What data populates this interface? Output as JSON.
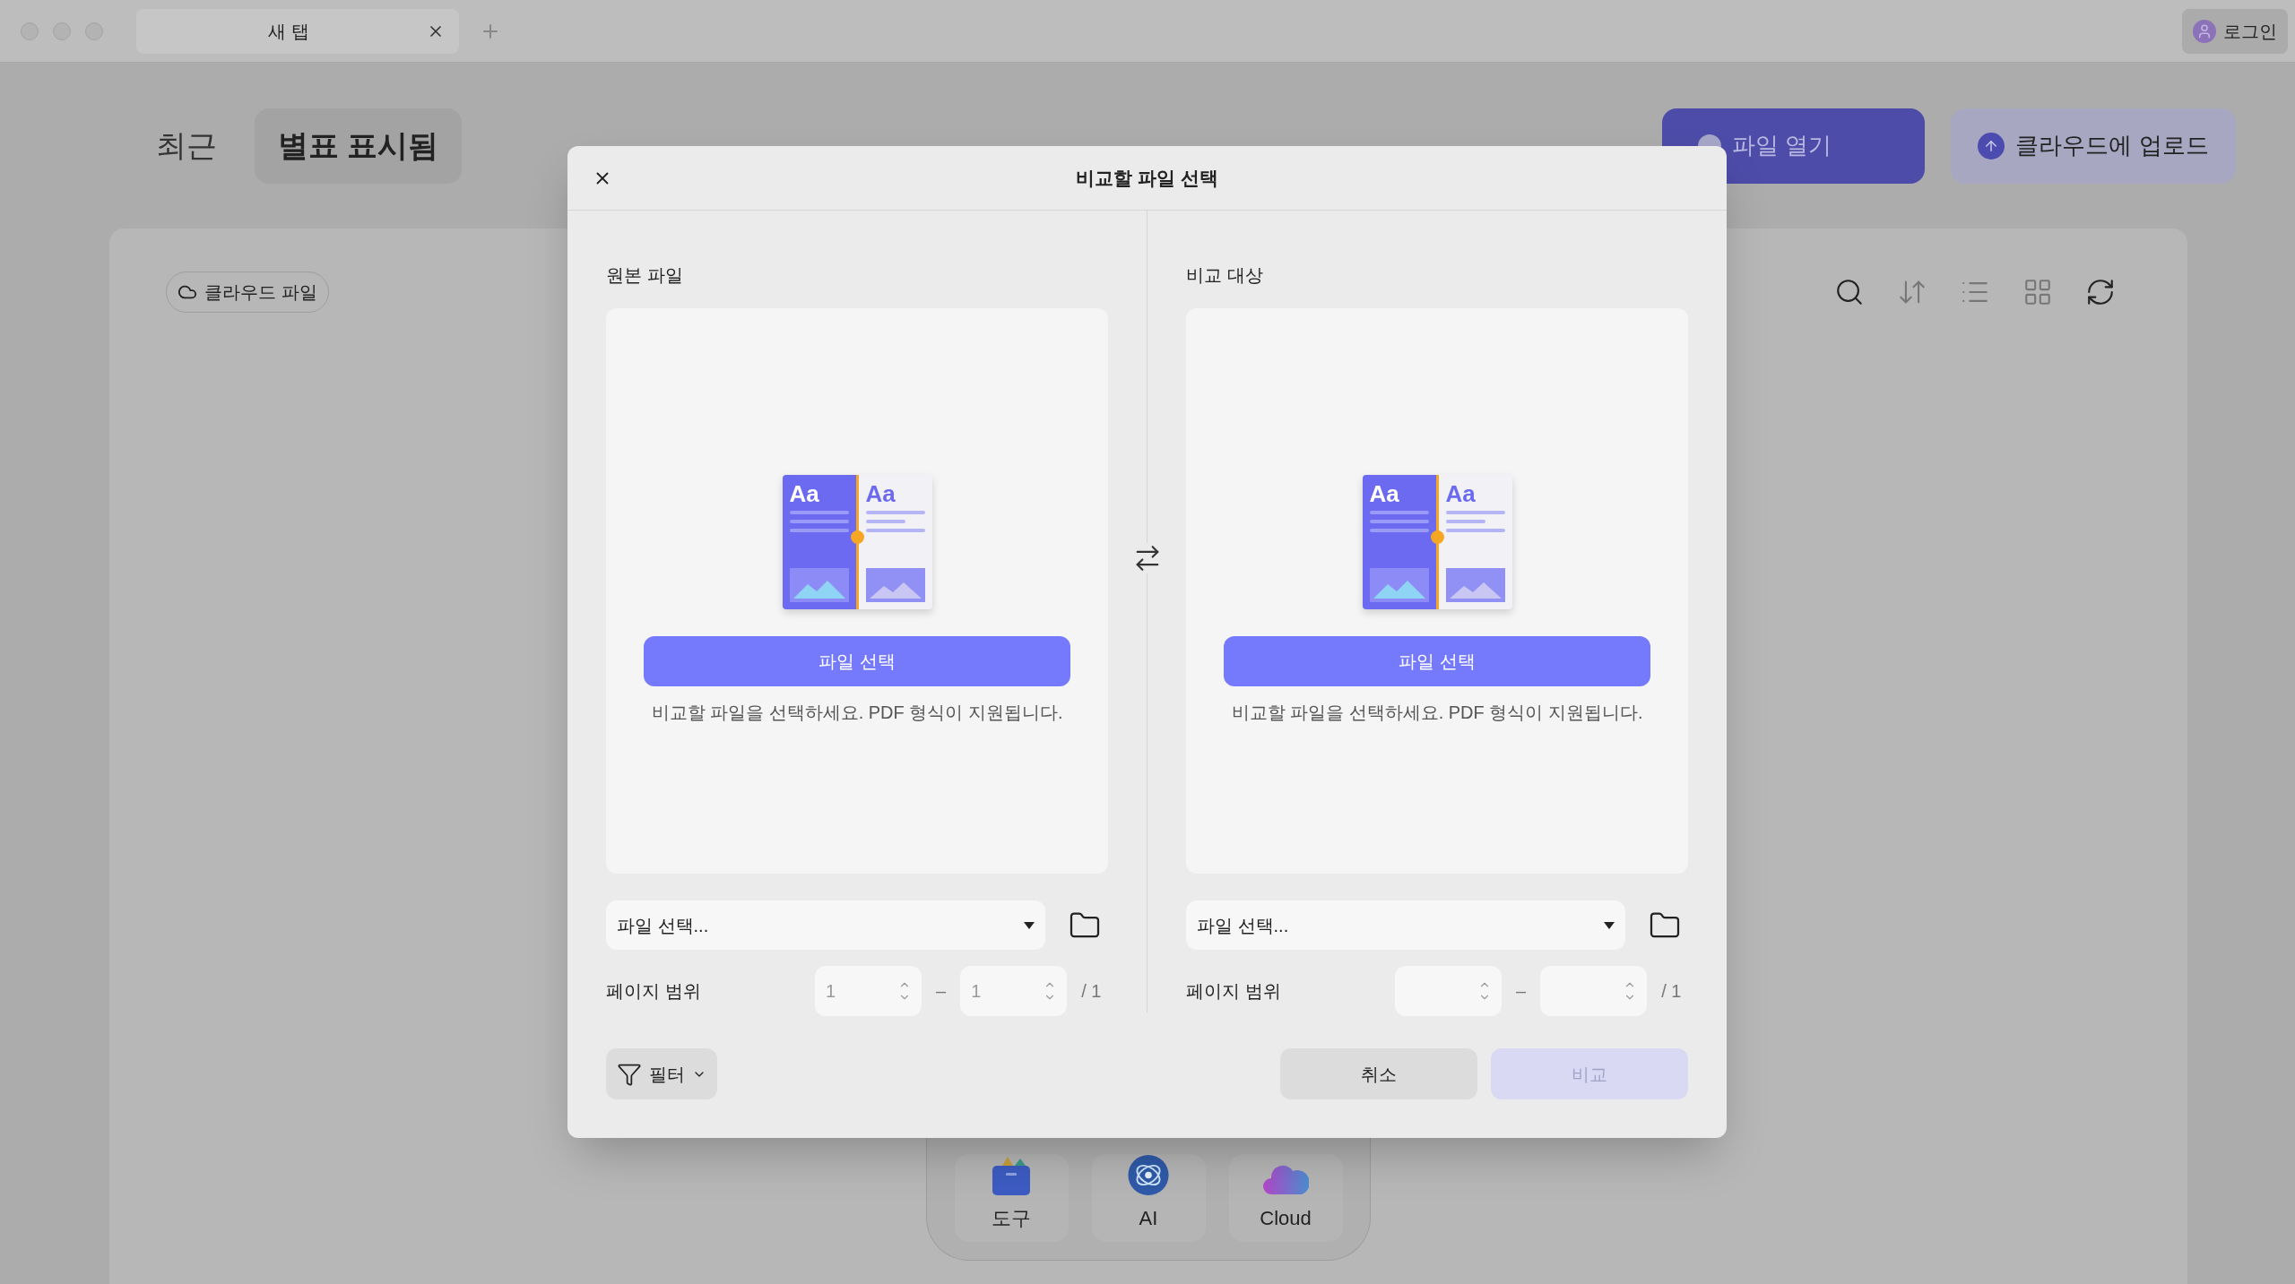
{
  "tab_bar": {
    "tabs": [
      {
        "label": "새 탭",
        "selected": true
      }
    ],
    "login": "로그인"
  },
  "header": {
    "nav": [
      {
        "label": "최근",
        "selected": false
      },
      {
        "label": "별표 표시됨",
        "selected": true
      }
    ],
    "open_file": "파일 열기",
    "upload": "클라우드에 업로드"
  },
  "content": {
    "filter_chip": "클라우드 파일"
  },
  "dock": [
    {
      "kind": "tools",
      "label": "도구"
    },
    {
      "kind": "ai",
      "label": "AI"
    },
    {
      "kind": "cloud",
      "label": "Cloud"
    }
  ],
  "dialog": {
    "title": "비교할 파일 선택",
    "panels": [
      {
        "heading": "원본 파일",
        "preview_labels": [
          "Aa",
          "Aa"
        ],
        "button": "파일 선택",
        "hint": "비교할 파일을 선택하세요. PDF 형식이 지원됩니다.",
        "select": "파일 선택...",
        "range_label": "페이지 범위",
        "from": "1",
        "separator": "–",
        "to": "1",
        "total": "/ 1"
      },
      {
        "heading": "비교 대상",
        "preview_labels": [
          "Aa",
          "Aa"
        ],
        "button": "파일 선택",
        "hint": "비교할 파일을 선택하세요. PDF 형식이 지원됩니다.",
        "select": "파일 선택...",
        "range_label": "페이지 범위",
        "separator": "–",
        "total": "/ 1"
      }
    ],
    "filter": "필터",
    "cancel": "취소",
    "compare": {
      "label": "비교",
      "disabled": true
    }
  }
}
